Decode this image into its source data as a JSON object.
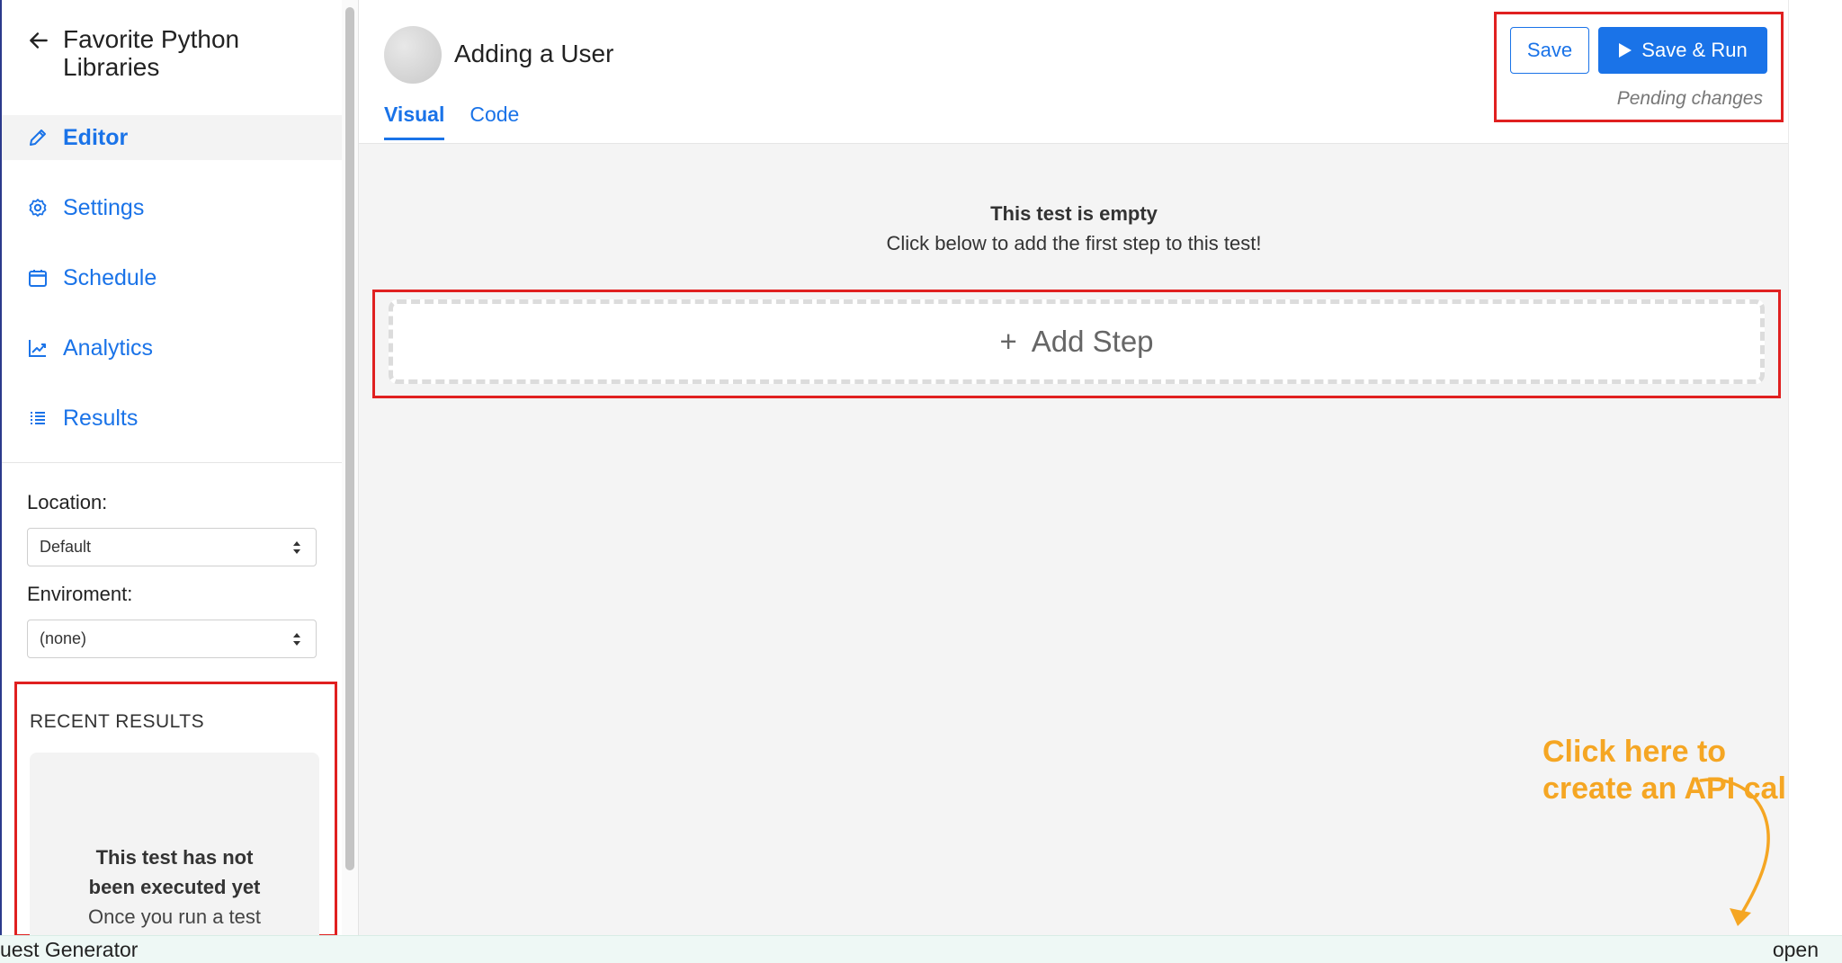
{
  "sidebar": {
    "project_title": "Favorite Python Libraries",
    "nav": [
      {
        "label": "Editor",
        "icon": "pencil-icon",
        "active": true
      },
      {
        "label": "Settings",
        "icon": "gear-icon",
        "active": false
      },
      {
        "label": "Schedule",
        "icon": "calendar-icon",
        "active": false
      },
      {
        "label": "Analytics",
        "icon": "chart-icon",
        "active": false
      },
      {
        "label": "Results",
        "icon": "list-icon",
        "active": false
      }
    ],
    "location_label": "Location:",
    "location_value": "Default",
    "environment_label": "Enviroment:",
    "environment_value": "(none)",
    "recent": {
      "title": "RECENT RESULTS",
      "empty_title": "This test has not been executed yet",
      "empty_text": "Once you run a test"
    }
  },
  "header": {
    "test_title": "Adding a User",
    "tabs": [
      {
        "label": "Visual",
        "active": true
      },
      {
        "label": "Code",
        "active": false
      }
    ],
    "save_label": "Save",
    "save_run_label": "Save & Run",
    "pending_text": "Pending changes"
  },
  "main": {
    "empty_title": "This test is empty",
    "empty_subtitle": "Click below to add the first step to this test!",
    "add_step_label": "Add Step",
    "callout_text": "Click here to create an API call"
  },
  "bottom_bar": {
    "left_text": "uest Generator",
    "right_text": "open"
  },
  "colors": {
    "accent": "#1a73e8",
    "highlight_box": "#e02020",
    "callout": "#f5a623"
  }
}
